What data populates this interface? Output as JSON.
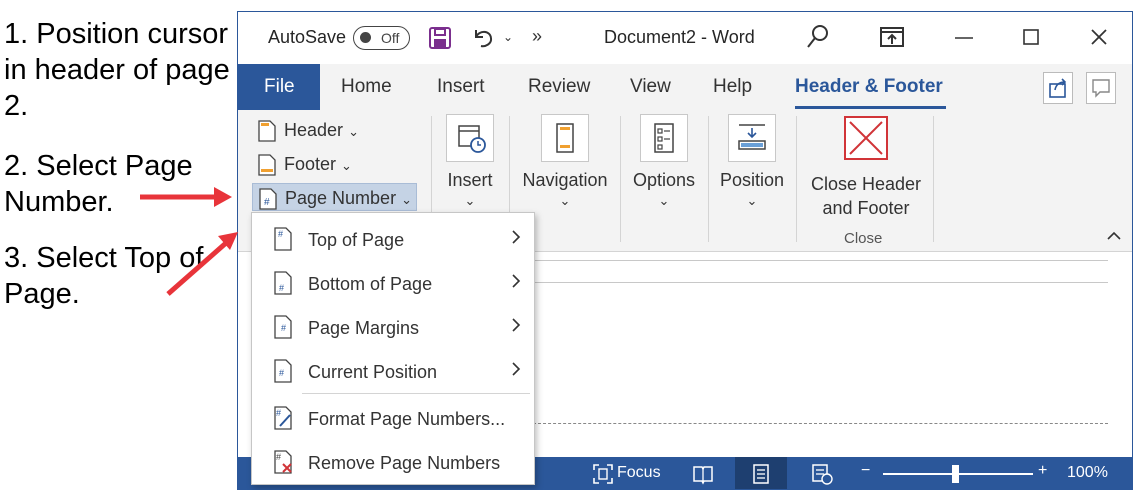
{
  "instructions": {
    "step1": "1. Position cursor in header of page 2.",
    "step2": "2. Select Page Number.",
    "step3": "3. Select Top of Page."
  },
  "titlebar": {
    "autosave_label": "AutoSave",
    "autosave_state": "Off",
    "more_label": "»",
    "document_title": "Document2  -  Word"
  },
  "tabs": {
    "file": "File",
    "home": "Home",
    "insert": "Insert",
    "review": "Review",
    "view": "View",
    "help": "Help",
    "header_footer": "Header & Footer"
  },
  "ribbon": {
    "header": "Header",
    "footer": "Footer",
    "page_number": "Page Number",
    "dropdown_chevron": "⌄",
    "insert": "Insert",
    "navigation": "Navigation",
    "options": "Options",
    "position": "Position",
    "close_header_footer_line1": "Close Header",
    "close_header_footer_line2": "and Footer",
    "close_group": "Close",
    "collapse": "^"
  },
  "page_number_menu": {
    "items": [
      {
        "label": "Top of Page",
        "has_submenu": true
      },
      {
        "label": "Bottom of Page",
        "has_submenu": true
      },
      {
        "label": "Page Margins",
        "has_submenu": true
      },
      {
        "label": "Current Position",
        "has_submenu": true
      },
      {
        "label": "Format Page Numbers...",
        "has_submenu": false
      },
      {
        "label": "Remove Page Numbers",
        "has_submenu": false
      }
    ]
  },
  "statusbar": {
    "focus": "Focus",
    "zoom_minus": "−",
    "zoom_plus": "+",
    "zoom_level": "100%"
  },
  "colors": {
    "word_blue": "#2b579a",
    "arrow_red": "#e8343a",
    "remove_red": "#d13438"
  }
}
